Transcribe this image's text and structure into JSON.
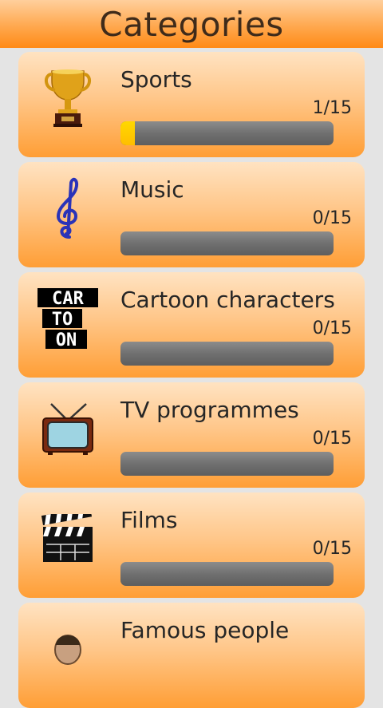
{
  "header": {
    "title": "Categories"
  },
  "categories": [
    {
      "label": "Sports",
      "count_text": "1/15",
      "progress": 0.067,
      "icon": "trophy-icon"
    },
    {
      "label": "Music",
      "count_text": "0/15",
      "progress": 0,
      "icon": "treble-clef-icon"
    },
    {
      "label": "Cartoon characters",
      "count_text": "0/15",
      "progress": 0,
      "icon": "cartoon-icon",
      "icon_text": [
        "CAR",
        "TO",
        "ON"
      ]
    },
    {
      "label": "TV programmes",
      "count_text": "0/15",
      "progress": 0,
      "icon": "television-icon"
    },
    {
      "label": "Films",
      "count_text": "0/15",
      "progress": 0,
      "icon": "clapperboard-icon"
    },
    {
      "label": "Famous people",
      "icon": "person-icon"
    }
  ],
  "colors": {
    "header": "#ff9a30",
    "card_top": "#ffe3c2",
    "card_bottom": "#ff9e35",
    "progress_track": "#707070",
    "progress_fill": "#ffc800"
  }
}
